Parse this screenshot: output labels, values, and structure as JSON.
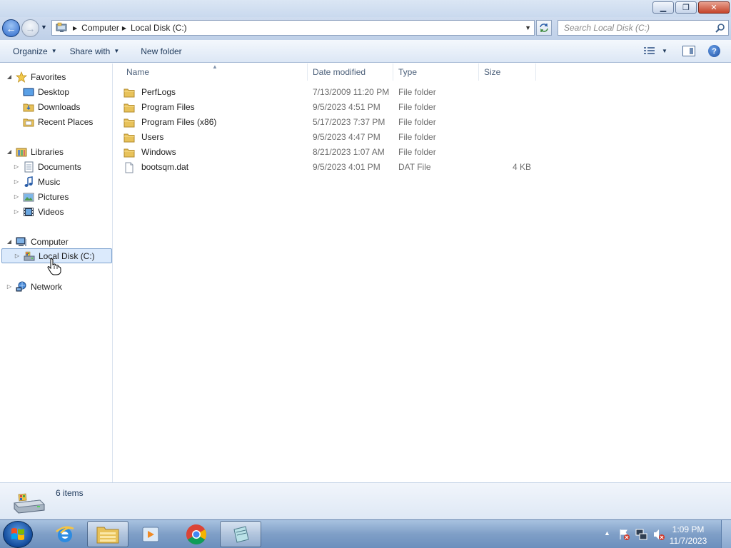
{
  "window": {
    "minimize_glyph": "▁",
    "restore_glyph": "❐",
    "close_glyph": "✕"
  },
  "navigation": {
    "back_glyph": "←",
    "forward_glyph": "→",
    "breadcrumbs": [
      "Computer",
      "Local Disk (C:)"
    ],
    "search_placeholder": "Search Local Disk (C:)"
  },
  "toolbar": {
    "organize_label": "Organize",
    "share_label": "Share with",
    "new_folder_label": "New folder",
    "help_label": "?"
  },
  "sidebar": {
    "favorites": {
      "label": "Favorites",
      "items": [
        "Desktop",
        "Downloads",
        "Recent Places"
      ]
    },
    "libraries": {
      "label": "Libraries",
      "items": [
        "Documents",
        "Music",
        "Pictures",
        "Videos"
      ]
    },
    "computer": {
      "label": "Computer",
      "items": [
        "Local Disk (C:)"
      ]
    },
    "network": {
      "label": "Network"
    }
  },
  "columns": {
    "name": "Name",
    "date_modified": "Date modified",
    "type": "Type",
    "size": "Size"
  },
  "files": [
    {
      "name": "PerfLogs",
      "date": "7/13/2009 11:20 PM",
      "type": "File folder",
      "size": "",
      "icon": "folder-icon"
    },
    {
      "name": "Program Files",
      "date": "9/5/2023 4:51 PM",
      "type": "File folder",
      "size": "",
      "icon": "folder-icon"
    },
    {
      "name": "Program Files (x86)",
      "date": "5/17/2023 7:37 PM",
      "type": "File folder",
      "size": "",
      "icon": "folder-icon"
    },
    {
      "name": "Users",
      "date": "9/5/2023 4:47 PM",
      "type": "File folder",
      "size": "",
      "icon": "folder-icon"
    },
    {
      "name": "Windows",
      "date": "8/21/2023 1:07 AM",
      "type": "File folder",
      "size": "",
      "icon": "folder-icon"
    },
    {
      "name": "bootsqm.dat",
      "date": "9/5/2023 4:01 PM",
      "type": "DAT File",
      "size": "4 KB",
      "icon": "file-icon"
    }
  ],
  "status": {
    "item_count": "6 items"
  },
  "taskbar": {
    "time": "1:09 PM",
    "date": "11/7/2023"
  },
  "colors": {
    "folder": "#e8c25a",
    "selection": "#dbeafc",
    "accent": "#2c67c9"
  }
}
